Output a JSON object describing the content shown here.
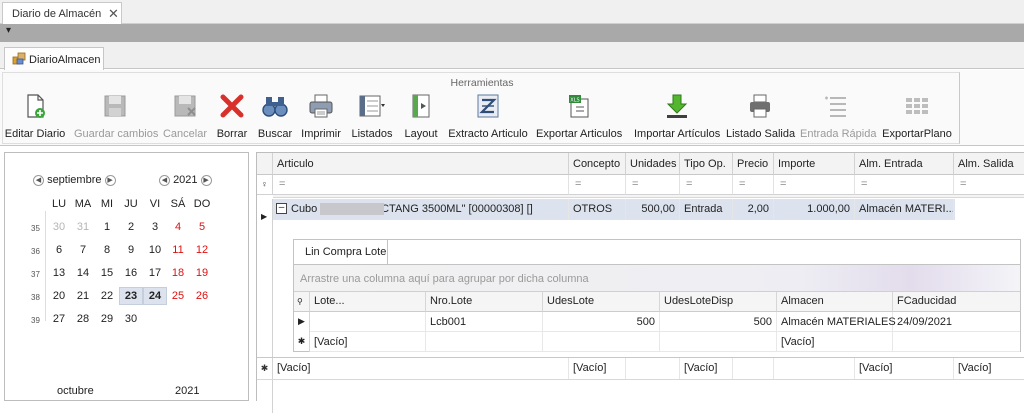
{
  "window": {
    "tab_title": "Diario de Almacén",
    "page_tab": "DiarioAlmacen"
  },
  "ribbon": {
    "group_title": "Herramientas",
    "buttons": [
      {
        "label": "Editar Diario",
        "icon": "edit-document-icon",
        "enabled": true
      },
      {
        "label": "Guardar cambios",
        "icon": "save-icon",
        "enabled": false
      },
      {
        "label": "Cancelar",
        "icon": "cancel-save-icon",
        "enabled": false
      },
      {
        "label": "Borrar",
        "icon": "delete-x-icon",
        "enabled": true
      },
      {
        "label": "Buscar",
        "icon": "binoculars-icon",
        "enabled": true
      },
      {
        "label": "Imprimir",
        "icon": "printer-icon",
        "enabled": true
      },
      {
        "label": "Listados",
        "icon": "list-dropdown-icon",
        "enabled": true
      },
      {
        "label": "Layout",
        "icon": "layout-icon",
        "enabled": true
      },
      {
        "label": "Extracto Articulo",
        "icon": "extract-icon",
        "enabled": true
      },
      {
        "label": "Exportar Articulos",
        "icon": "export-xls-icon",
        "enabled": true
      },
      {
        "label": "Importar Artículos",
        "icon": "import-download-icon",
        "enabled": true
      },
      {
        "label": "Listado Salida",
        "icon": "print-list-icon",
        "enabled": true
      },
      {
        "label": "Entrada Rápida",
        "icon": "quick-entry-icon",
        "enabled": false
      },
      {
        "label": "ExportarPlano",
        "icon": "export-flat-icon",
        "enabled": true
      }
    ]
  },
  "calendar": {
    "left": {
      "month": "septiembre",
      "year": "2021"
    },
    "weekdays": [
      "LU",
      "MA",
      "MI",
      "JU",
      "VI",
      "SÁ",
      "DO"
    ],
    "weeks": [
      {
        "num": "35",
        "days": [
          "30",
          "31",
          "1",
          "2",
          "3",
          "4",
          "5"
        ]
      },
      {
        "num": "36",
        "days": [
          "6",
          "7",
          "8",
          "9",
          "10",
          "11",
          "12"
        ]
      },
      {
        "num": "37",
        "days": [
          "13",
          "14",
          "15",
          "16",
          "17",
          "18",
          "19"
        ]
      },
      {
        "num": "38",
        "days": [
          "20",
          "21",
          "22",
          "23",
          "24",
          "25",
          "26"
        ]
      },
      {
        "num": "39",
        "days": [
          "27",
          "28",
          "29",
          "30",
          "",
          "",
          ""
        ]
      }
    ],
    "selected_days": [
      "23",
      "24"
    ],
    "next": {
      "month": "octubre",
      "year": "2021"
    }
  },
  "grid": {
    "columns": [
      "Articulo",
      "Concepto",
      "Unidades",
      "Tipo Op.",
      "Precio",
      "Importe",
      "Alm. Entrada",
      "Alm. Salida"
    ],
    "filter_symbol": "=",
    "row": {
      "articulo": "Cubo -              \"CUBO RECTANG 3500ML\" [00000308] []",
      "concepto": "OTROS",
      "unidades": "500,00",
      "tipo_op": "Entrada",
      "precio": "2,00",
      "importe": "1.000,00",
      "alm_entrada": "Almacén MATERI..."
    },
    "new_row": {
      "articulo": "[Vacío]",
      "concepto": "[Vacío]",
      "tipo_op": "[Vacío]",
      "alm_entrada": "[Vacío]",
      "alm_salida": "[Vacío]"
    }
  },
  "detail": {
    "tab": "Lin Compra Lote",
    "group_hint": "Arrastre una columna aquí para agrupar por dicha columna",
    "columns": [
      "Lote...",
      "Nro.Lote",
      "UdesLote",
      "UdesLoteDisp",
      "Almacen",
      "FCaducidad"
    ],
    "row": {
      "lote": "",
      "nro_lote": "Lcb001",
      "udes_lote": "500",
      "udes_lote_disp": "500",
      "almacen": "Almacén MATERIALES",
      "fcaducidad": "24/09/2021"
    },
    "new_row": {
      "lote": "[Vacío]",
      "almacen": "[Vacío]"
    }
  }
}
